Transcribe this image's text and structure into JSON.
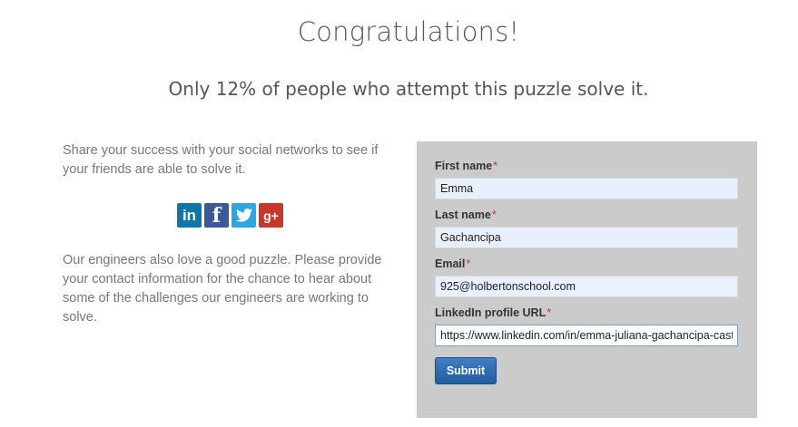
{
  "header": {
    "title": "Congratulations!",
    "subtitle": "Only 12% of people who attempt this puzzle solve it."
  },
  "share": {
    "text": "Share your success with your social networks to see if your friends are able to solve it.",
    "buttons": [
      {
        "icon": "linkedin-icon",
        "glyph": "in",
        "color": "#0e76a8"
      },
      {
        "icon": "facebook-icon",
        "glyph": "f",
        "color": "#3b5998"
      },
      {
        "icon": "twitter-icon",
        "glyph": "bird",
        "color": "#2ea7e0"
      },
      {
        "icon": "google-plus-icon",
        "glyph": "g+",
        "color": "#c8372c"
      }
    ]
  },
  "engineers_text": "Our engineers also love a good puzzle. Please provide your contact information for the chance to hear about some of the challenges our engineers are working to solve.",
  "form": {
    "required_marker": "*",
    "first_name": {
      "label": "First name",
      "value": "Emma"
    },
    "last_name": {
      "label": "Last name",
      "value": "Gachancipa"
    },
    "email": {
      "label": "Email",
      "value": "925@holbertonschool.com"
    },
    "linkedin": {
      "label": "LinkedIn profile URL",
      "value": "https://www.linkedin.com/in/emma-juliana-gachancipa-caste"
    },
    "submit_label": "Submit"
  },
  "colors": {
    "panel_bg": "#cbcbcb",
    "autofill_bg": "#e8f0fe",
    "button_blue": "#2a6bb0",
    "required_red": "#c0392b"
  }
}
